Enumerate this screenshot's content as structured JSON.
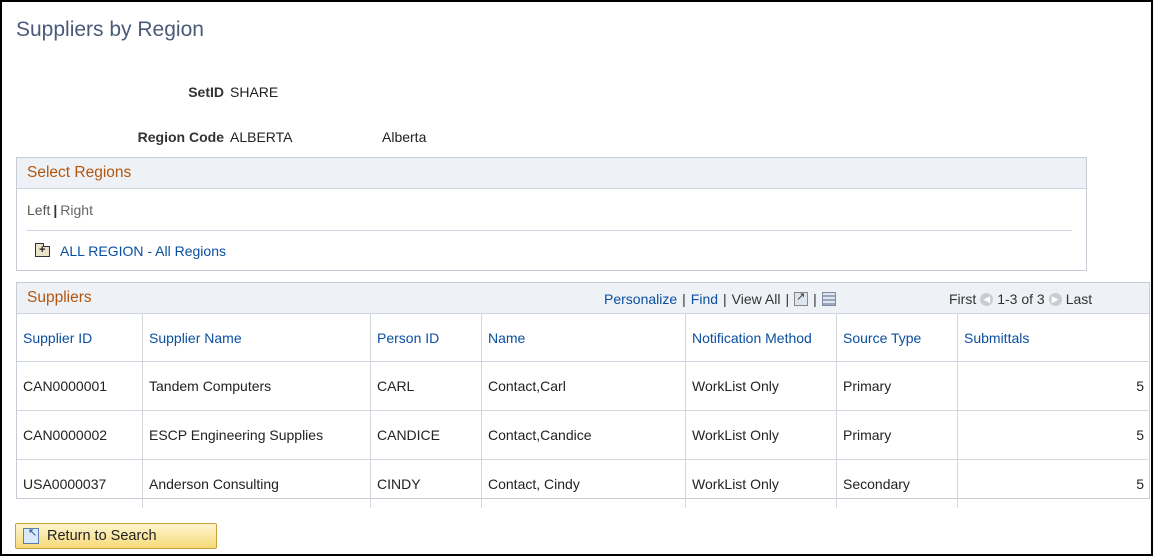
{
  "page": {
    "title": "Suppliers by Region"
  },
  "fields": {
    "setid_label": "SetID",
    "setid_value": "SHARE",
    "region_code_label": "Region Code",
    "region_code_value": "ALBERTA",
    "region_description": "Alberta"
  },
  "select_regions": {
    "title": "Select Regions",
    "left_label": "Left",
    "separator": "|",
    "right_label": "Right",
    "tree_node": {
      "icon": "folder-plus-icon",
      "label": "ALL REGION - All Regions"
    }
  },
  "suppliers": {
    "title": "Suppliers",
    "tools": {
      "personalize": "Personalize",
      "find": "Find",
      "view_all": "View All",
      "separator": "|",
      "zoom_icon": "new-window-icon",
      "download_icon": "download-grid-icon"
    },
    "nav": {
      "first": "First",
      "range": "1-3 of 3",
      "last": "Last"
    },
    "columns": [
      "Supplier ID",
      "Supplier Name",
      "Person ID",
      "Name",
      "Notification Method",
      "Source Type",
      "Submittals"
    ],
    "rows": [
      [
        "CAN0000001",
        "Tandem Computers",
        "CARL",
        "Contact,Carl",
        "WorkList Only",
        "Primary",
        "5"
      ],
      [
        "CAN0000002",
        "ESCP Engineering Supplies",
        "CANDICE",
        "Contact,Candice",
        "WorkList Only",
        "Primary",
        "5"
      ],
      [
        "USA0000037",
        "Anderson Consulting",
        "CINDY",
        "Contact, Cindy",
        "WorkList Only",
        "Secondary",
        "5"
      ]
    ]
  },
  "footer": {
    "return_button": "Return to Search",
    "return_icon": "return-search-icon"
  }
}
